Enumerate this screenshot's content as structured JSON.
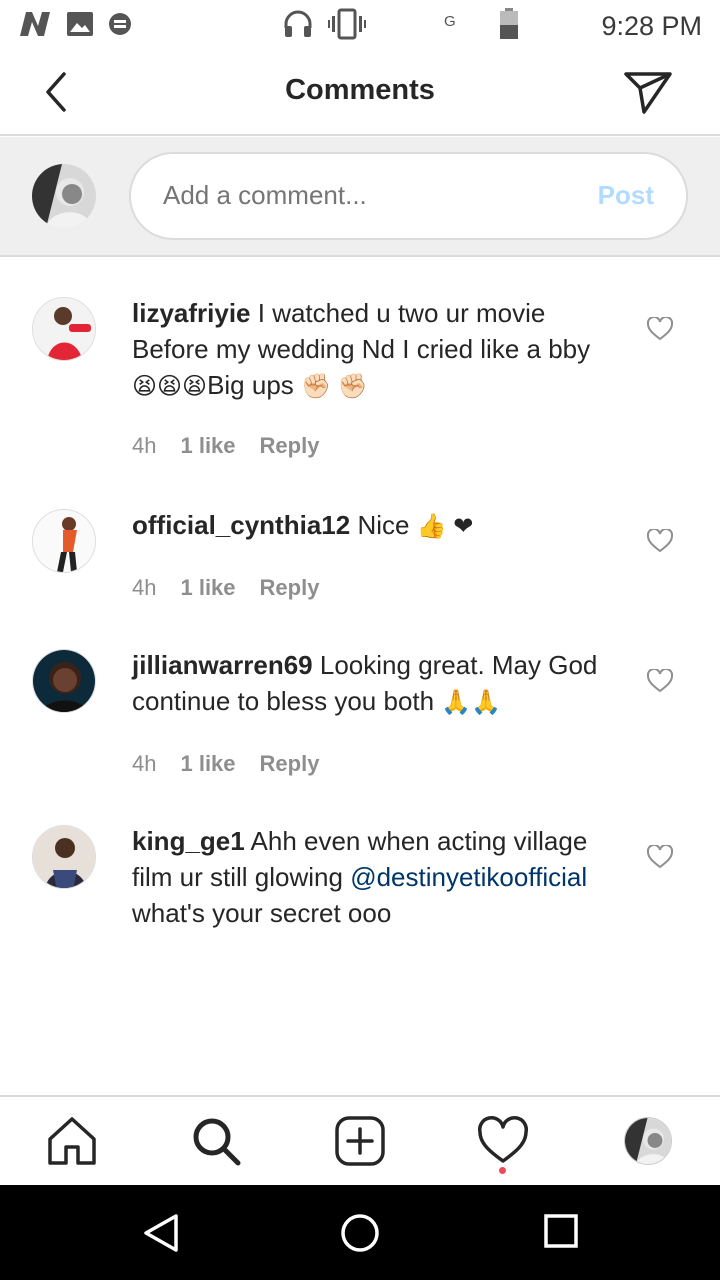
{
  "status_bar": {
    "time": "9:28 PM",
    "network": "G",
    "icons": [
      "n-icon",
      "image-icon",
      "message-icon",
      "headset-icon",
      "vibrate-icon",
      "battery-icon"
    ]
  },
  "header": {
    "title": "Comments",
    "icons": [
      "back-arrow-icon",
      "send-icon"
    ]
  },
  "composer": {
    "placeholder": "Add a comment...",
    "post_label": "Post",
    "post_color": "#b3dbff"
  },
  "comments": [
    {
      "username": "lizyafriyie",
      "text": "I watched u two ur movie Before my wedding Nd I cried like a bby",
      "emojis1": "😫😫😫",
      "text2": "Big ups",
      "emojis2": "✊🏻 ✊🏻",
      "time": "4h",
      "likes": "1 like",
      "reply": "Reply"
    },
    {
      "username": "official_cynthia12",
      "text": "Nice",
      "emojis1": "👍 ❤",
      "time": "4h",
      "likes": "1 like",
      "reply": "Reply"
    },
    {
      "username": "jillianwarren69",
      "text": "Looking great. May God continue to bless you both",
      "emojis1": "🙏🙏",
      "time": "4h",
      "likes": "1 like",
      "reply": "Reply"
    },
    {
      "username": "king_ge1",
      "text": "Ahh even when acting village film ur still glowing",
      "mention": "@destinyetikoofficial",
      "text2": "what's your secret ooo"
    }
  ],
  "colors": {
    "mention": "#003569",
    "notification_dot": "#ed4956",
    "meta": "#8e8e8e"
  },
  "bottom_nav": {
    "icons": [
      "home-icon",
      "search-icon",
      "add-post-icon",
      "activity-heart-icon",
      "profile-avatar"
    ]
  },
  "system_nav": {
    "icons": [
      "back-triangle-icon",
      "home-circle-icon",
      "recents-square-icon"
    ]
  }
}
